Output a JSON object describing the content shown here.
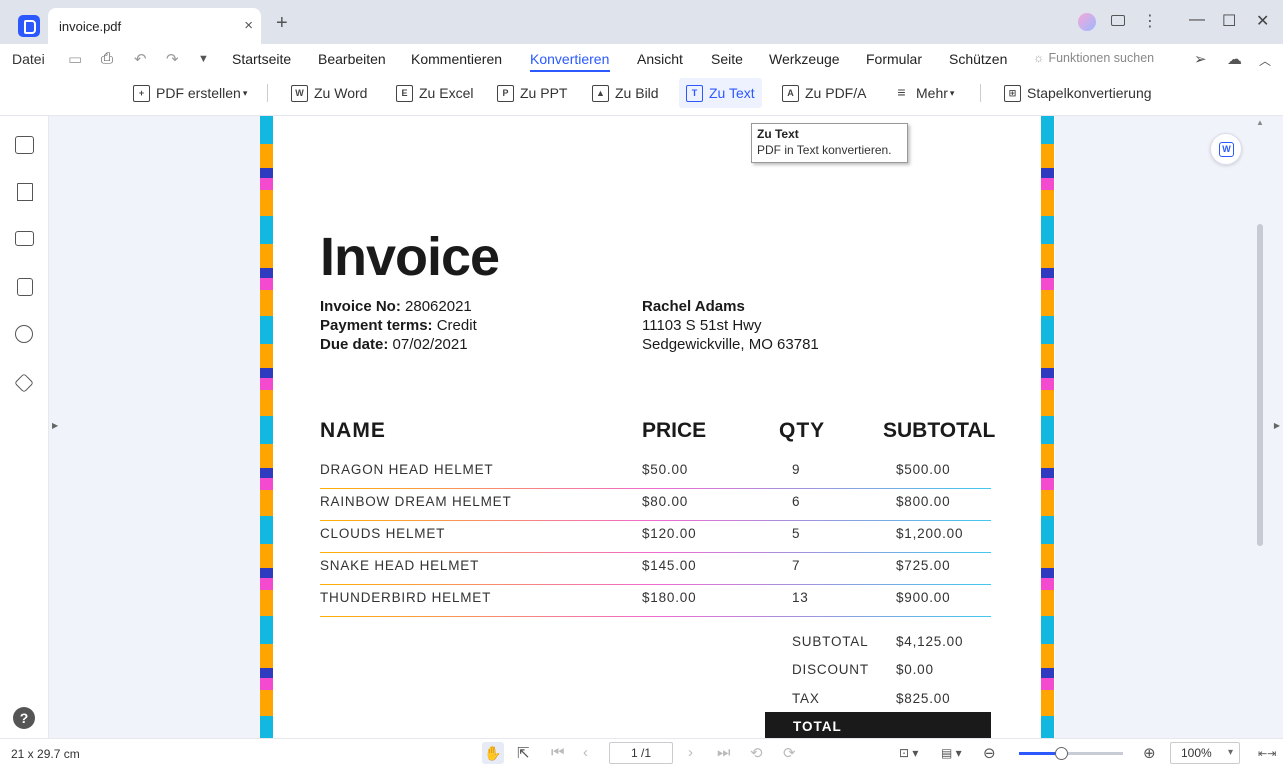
{
  "titlebar": {
    "tab_title": "invoice.pdf",
    "close_glyph": "×",
    "new_tab_glyph": "+",
    "more_glyph": "⋮",
    "minimize_glyph": "—",
    "maximize_glyph": "☐",
    "close_window_glyph": "✕"
  },
  "menubar": {
    "file": "Datei",
    "tabs": [
      "Startseite",
      "Bearbeiten",
      "Kommentieren",
      "Konvertieren",
      "Ansicht",
      "Seite",
      "Werkzeuge",
      "Formular",
      "Schützen"
    ],
    "active_tab": "Konvertieren",
    "search_placeholder": "Funktionen suchen"
  },
  "ribbon": {
    "items": [
      {
        "label": "PDF erstellen",
        "icon": "create-pdf-icon"
      },
      {
        "label": "Zu Word",
        "icon": "word-icon"
      },
      {
        "label": "Zu Excel",
        "icon": "excel-icon"
      },
      {
        "label": "Zu PPT",
        "icon": "ppt-icon"
      },
      {
        "label": "Zu Bild",
        "icon": "image-icon"
      },
      {
        "label": "Zu Text",
        "icon": "text-icon"
      },
      {
        "label": "Zu PDF/A",
        "icon": "pdfa-icon"
      },
      {
        "label": "Mehr",
        "icon": "more-icon"
      },
      {
        "label": "Stapelkonvertierung",
        "icon": "batch-icon"
      }
    ],
    "selected": "Zu Text"
  },
  "tooltip": {
    "title": "Zu Text",
    "description": "PDF in Text konvertieren."
  },
  "invoice": {
    "title": "Invoice",
    "invoice_no_label": "Invoice No:",
    "invoice_no": "28062021",
    "payment_terms_label": "Payment terms:",
    "payment_terms": "Credit",
    "due_date_label": "Due date:",
    "due_date": "07/02/2021",
    "customer": {
      "name": "Rachel Adams",
      "address1": "11103 S 51st Hwy",
      "address2": "Sedgewickville, MO 63781"
    },
    "columns": [
      "NAME",
      "PRICE",
      "QTY",
      "SUBTOTAL"
    ],
    "rows": [
      [
        "DRAGON HEAD HELMET",
        "$50.00",
        "9",
        "$500.00"
      ],
      [
        "RAINBOW DREAM HELMET",
        "$80.00",
        "6",
        "$800.00"
      ],
      [
        "CLOUDS HELMET",
        "$120.00",
        "5",
        "$1,200.00"
      ],
      [
        "SNAKE HEAD HELMET",
        "$145.00",
        "7",
        "$725.00"
      ],
      [
        "THUNDERBIRD HELMET",
        "$180.00",
        "13",
        "$900.00"
      ]
    ],
    "summary": [
      {
        "label": "SUBTOTAL",
        "value": "$4,125.00"
      },
      {
        "label": "DISCOUNT",
        "value": "$0.00"
      },
      {
        "label": "TAX",
        "value": "$825.00"
      }
    ],
    "total_label": "TOTAL"
  },
  "statusbar": {
    "page_size": "21 x 29.7 cm",
    "page_indicator": "1 /1",
    "zoom": "100%",
    "zoom_level": 0.4
  },
  "colors": {
    "accent": "#2b59ff",
    "titlebar": "#dfe3ec",
    "doc_bg": "#f0f3f9"
  }
}
